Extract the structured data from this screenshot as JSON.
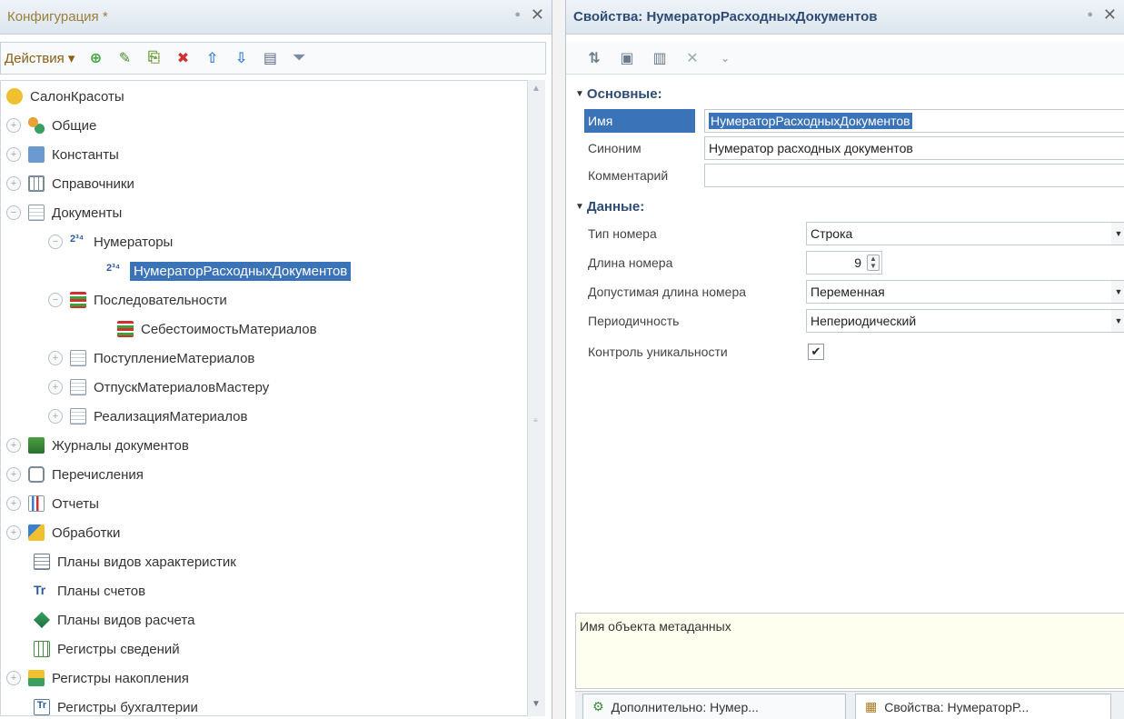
{
  "config_panel": {
    "title": "Конфигурация *",
    "actions_label": "Действия ▾",
    "tree": [
      {
        "label": "СалонКрасоты"
      },
      {
        "label": "Общие"
      },
      {
        "label": "Константы"
      },
      {
        "label": "Справочники"
      },
      {
        "label": "Документы"
      },
      {
        "label": "Нумераторы"
      },
      {
        "label": "НумераторРасходныхДокументов"
      },
      {
        "label": "Последовательности"
      },
      {
        "label": "СебестоимостьМатериалов"
      },
      {
        "label": "ПоступлениеМатериалов"
      },
      {
        "label": "ОтпускМатериаловМастеру"
      },
      {
        "label": "РеализацияМатериалов"
      },
      {
        "label": "Журналы документов"
      },
      {
        "label": "Перечисления"
      },
      {
        "label": "Отчеты"
      },
      {
        "label": "Обработки"
      },
      {
        "label": "Планы видов характеристик"
      },
      {
        "label": "Планы счетов"
      },
      {
        "label": "Планы видов расчета"
      },
      {
        "label": "Регистры сведений"
      },
      {
        "label": "Регистры накопления"
      },
      {
        "label": "Регистры бухгалтерии"
      }
    ]
  },
  "props_panel": {
    "title": "Свойства: НумераторРасходныхДокументов",
    "groups": {
      "basic": "Основные:",
      "data": "Данные:"
    },
    "fields": {
      "name_label": "Имя",
      "name_value": "НумераторРасходныхДокументов",
      "synonym_label": "Синоним",
      "synonym_value": "Нумератор расходных документов",
      "comment_label": "Комментарий",
      "comment_value": "",
      "number_type_label": "Тип номера",
      "number_type_value": "Строка",
      "number_length_label": "Длина номера",
      "number_length_value": "9",
      "allowed_length_label": "Допустимая длина номера",
      "allowed_length_value": "Переменная",
      "periodicity_label": "Периодичность",
      "periodicity_value": "Непериодический",
      "uniqueness_label": "Контроль уникальности",
      "uniqueness_checked": true
    },
    "description": "Имя объекта метаданных",
    "tabs": [
      {
        "label": "Дополнительно: Нумер..."
      },
      {
        "label": "Свойства: НумераторР..."
      }
    ]
  },
  "colors": {
    "selection": "#3b73b9",
    "title_brown": "#9a7e3a",
    "title_blue": "#2e4b73"
  }
}
